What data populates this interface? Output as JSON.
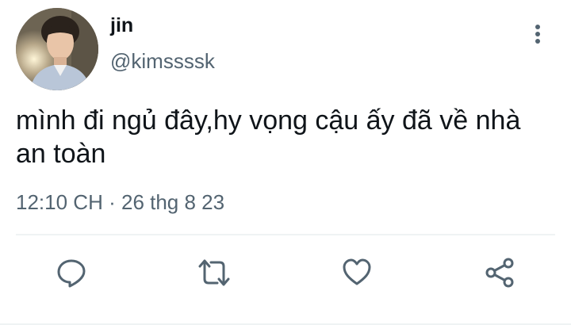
{
  "tweet": {
    "display_name": "jin",
    "handle": "@kimssssk",
    "text": "mình đi ngủ đây,hy vọng cậu ấy đã về nhà an toàn",
    "time": "12:10 CH",
    "separator": "·",
    "date": "26 thg 8 23"
  },
  "icons": {
    "more": "more-vertical-icon",
    "reply": "reply-icon",
    "retweet": "retweet-icon",
    "like": "heart-icon",
    "share": "share-icon"
  },
  "colors": {
    "text_primary": "#0f1419",
    "text_secondary": "#536471",
    "divider": "#eff3f4",
    "icon": "#536471"
  }
}
